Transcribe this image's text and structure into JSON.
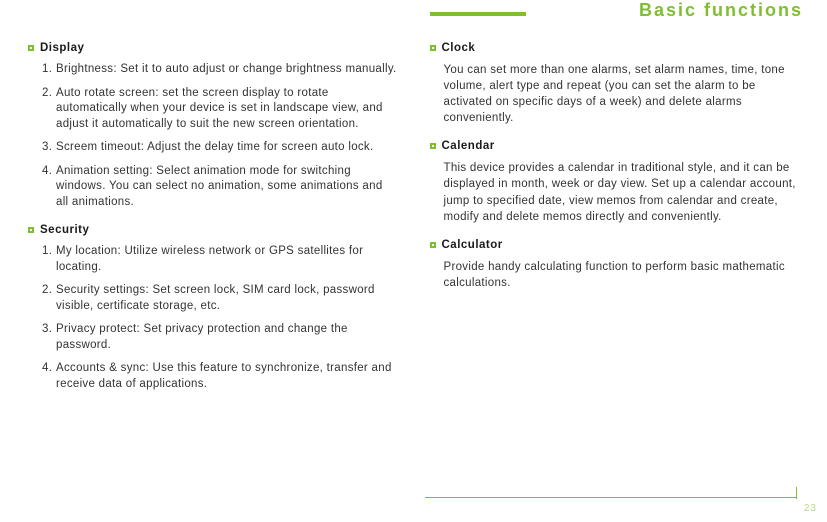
{
  "header": {
    "title": "Basic functions"
  },
  "left": {
    "sections": [
      {
        "title": "Display",
        "items": [
          "Brightness: Set it to auto adjust or change brightness manually.",
          "Auto rotate screen: set the screen display to rotate automatically when your device is set in landscape view, and adjust it automatically to suit the new screen orientation.",
          "Screem timeout: Adjust the delay time for screen auto lock.",
          "Animation setting: Select animation mode for switching windows. You can select no animation, some animations and all animations."
        ]
      },
      {
        "title": "Security",
        "items": [
          "My location: Utilize wireless network or GPS satellites for locating.",
          "Security settings: Set screen lock, SIM card lock, password visible, certificate storage, etc.",
          "Privacy protect: Set privacy protection and change the password.",
          "Accounts & sync: Use this feature to synchronize, transfer and receive data of applications."
        ]
      }
    ]
  },
  "right": {
    "sections": [
      {
        "title": "Clock",
        "body": "You can set more than one alarms, set alarm names, time, tone volume, alert type and repeat (you can set the alarm to be activated on specific days of a week) and delete alarms conveniently."
      },
      {
        "title": "Calendar",
        "body": "This device provides a calendar in traditional style, and it can be displayed in month, week or day view. Set up a calendar account, jump to specified date, view memos from calendar and create, modify and delete memos directly and conveniently."
      },
      {
        "title": "Calculator",
        "body": "Provide handy calculating function to perform basic mathematic calculations."
      }
    ]
  },
  "page": "23"
}
